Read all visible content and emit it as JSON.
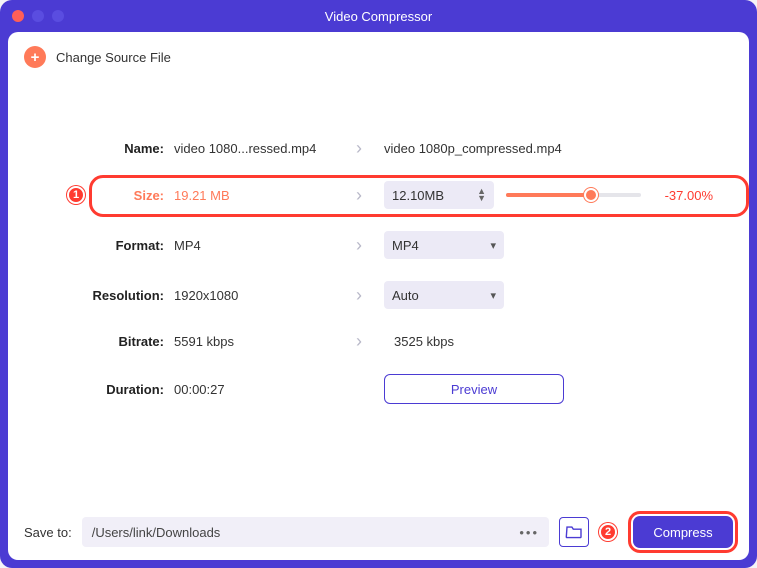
{
  "window": {
    "title": "Video Compressor"
  },
  "header": {
    "change_source": "Change Source File",
    "plus_icon": "+"
  },
  "rows": {
    "name": {
      "label": "Name:",
      "src": "video 1080...ressed.mp4",
      "out": "video 1080p_compressed.mp4"
    },
    "size": {
      "label": "Size:",
      "src": "19.21 MB",
      "out": "12.10MB",
      "percent": "-37.00%"
    },
    "format": {
      "label": "Format:",
      "src": "MP4",
      "out": "MP4"
    },
    "resolution": {
      "label": "Resolution:",
      "src": "1920x1080",
      "out": "Auto"
    },
    "bitrate": {
      "label": "Bitrate:",
      "src": "5591 kbps",
      "out": "3525 kbps"
    },
    "duration": {
      "label": "Duration:",
      "src": "00:00:27"
    }
  },
  "preview": {
    "label": "Preview"
  },
  "footer": {
    "save_label": "Save to:",
    "path": "/Users/link/Downloads",
    "compress": "Compress"
  },
  "callouts": {
    "one": "1",
    "two": "2"
  },
  "glyphs": {
    "arrow": "›",
    "caret": "▾",
    "up": "▲",
    "down": "▼",
    "dots": "•••"
  }
}
